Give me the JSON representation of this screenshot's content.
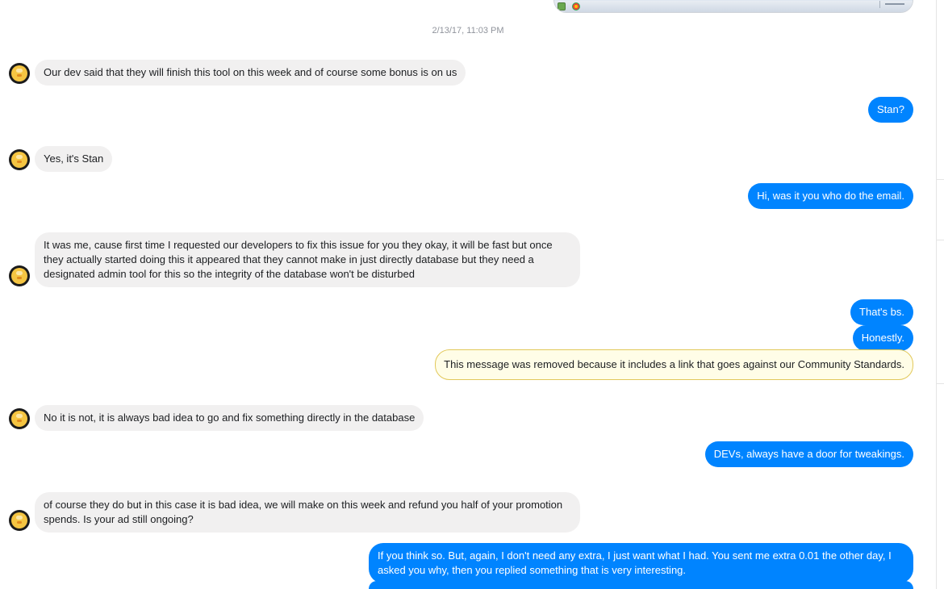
{
  "colors": {
    "outgoing_bubble": "#0084ff",
    "incoming_bubble": "#f1f0f0",
    "removed_notice_bg": "#fffde7",
    "removed_notice_border": "#e2c85a",
    "timestamp_text": "#90949c"
  },
  "contact": {
    "avatar_icon": "duck-avatar-icon"
  },
  "timestamp": "2/13/17, 11:03 PM",
  "messages": [
    {
      "sender": "them",
      "text": "Our dev said that they will finish this tool on this week and of course some bonus is on us"
    },
    {
      "sender": "me",
      "text": "Stan?"
    },
    {
      "sender": "them",
      "text": "Yes, it's Stan"
    },
    {
      "sender": "me",
      "text": "Hi, was it you who do the email."
    },
    {
      "sender": "them",
      "text": "It was me, cause first time I requested our developers to fix this issue for you they okay, it will be fast but once they actually started doing this it appeared that they cannot make in just directly database but they need a designated admin tool for this so the integrity of the database won't be disturbed"
    },
    {
      "sender": "me",
      "text": "That's bs."
    },
    {
      "sender": "me",
      "text": "Honestly."
    },
    {
      "sender": "me",
      "type": "removed",
      "text": "This message was removed because it includes a link that goes against our Community Standards."
    },
    {
      "sender": "them",
      "text": "No it is not, it is always bad idea to go and fix something directly in the database"
    },
    {
      "sender": "me",
      "text": "DEVs, always have a door for tweakings."
    },
    {
      "sender": "them",
      "text": "of course they do but in this case it is bad idea, we will make on this week and refund you half of your promotion spends. Is your ad still ongoing?"
    },
    {
      "sender": "me",
      "text": "If you think so. But, again, I don't need any extra, I just want what I had. You sent me extra 0.01 the other day, I asked you why, then you replied something that is very interesting."
    }
  ]
}
